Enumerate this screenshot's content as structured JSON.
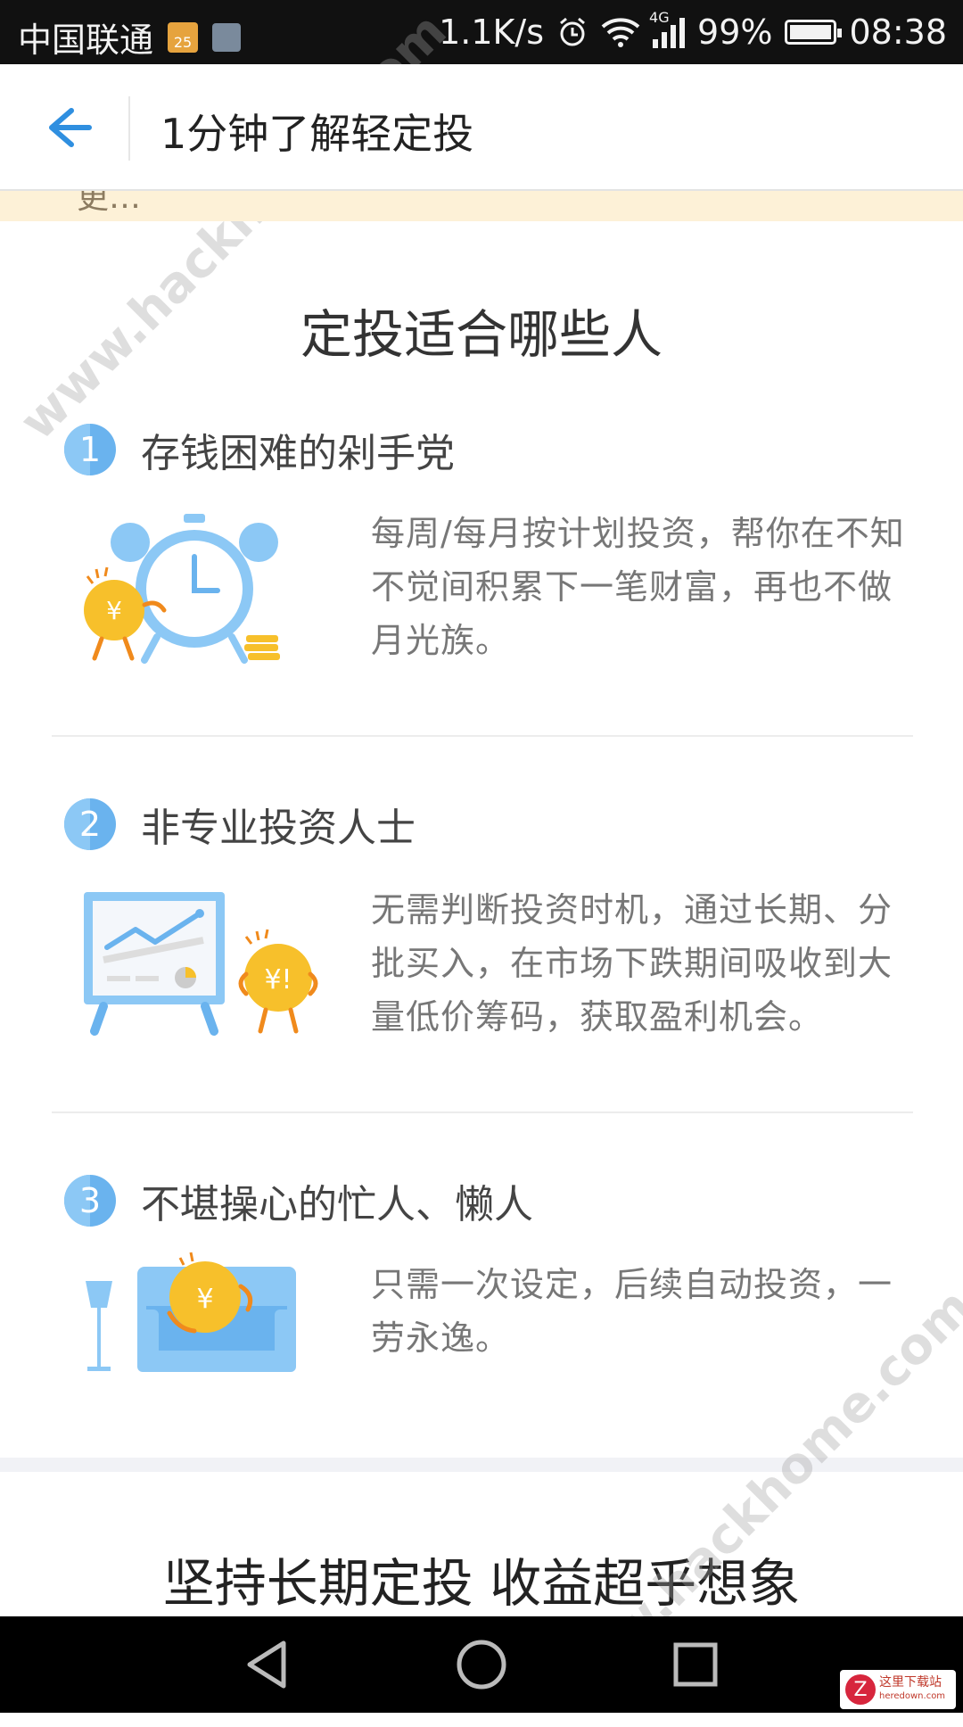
{
  "status_bar": {
    "carrier": "中国联通",
    "calendar_badge": "25",
    "net_speed": "1.1K/s",
    "network_type": "4G",
    "battery": "99%",
    "time": "08:38"
  },
  "app_bar": {
    "title": "1分钟了解轻定投"
  },
  "notice_strip": {
    "text": "更…"
  },
  "section1": {
    "title": "定投适合哪些人",
    "items": [
      {
        "number": "1",
        "heading": "存钱困难的剁手党",
        "desc": "每周/每月按计划投资，帮你在不知不觉间积累下一笔财富，再也不做月光族。",
        "illustration": "alarm-clock-coin-illustration"
      },
      {
        "number": "2",
        "heading": "非专业投资人士",
        "desc": "无需判断投资时机，通过长期、分批买入，在市场下跌期间吸收到大量低价筹码，获取盈利机会。",
        "illustration": "chart-board-coin-illustration"
      },
      {
        "number": "3",
        "heading": "不堪操心的忙人、懒人",
        "desc": "只需一次设定，后续自动投资，一劳永逸。",
        "illustration": "sofa-coin-illustration"
      }
    ]
  },
  "section2": {
    "title": "坚持长期定投 收益超乎想象"
  },
  "watermark": {
    "text": "www.hackhome.com",
    "logo_text_cn": "这里下载站",
    "logo_text_en": "heredown.com"
  },
  "colors": {
    "accent_blue": "#2f8fe0",
    "badge_blue": "#6ab3ee",
    "coin_yellow": "#f7c02b",
    "notice_bg": "#fdf1d7"
  }
}
